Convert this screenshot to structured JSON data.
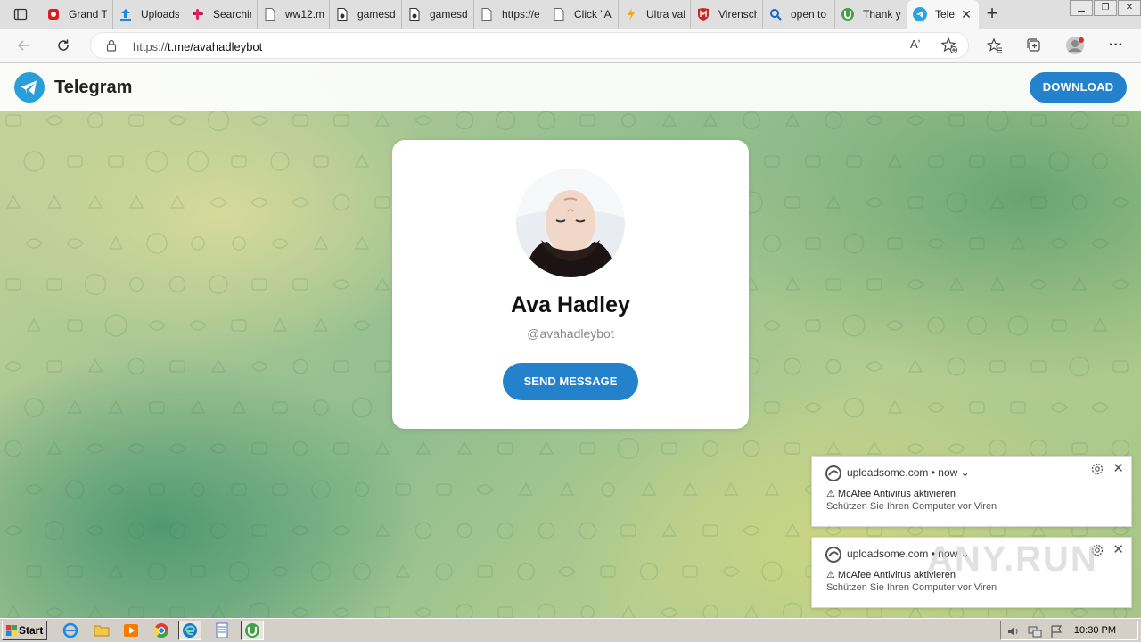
{
  "browser": {
    "tabs": [
      {
        "title": "Grand TI",
        "icon": "red-app-icon",
        "color": "#d81b1b"
      },
      {
        "title": "Uploads",
        "icon": "upload-icon",
        "color": "#1e88e5"
      },
      {
        "title": "Searchin",
        "icon": "slack-icon",
        "color": "#c2185b"
      },
      {
        "title": "ww12.m",
        "icon": "page-icon",
        "color": "#666666"
      },
      {
        "title": "gamesd",
        "icon": "lock-page-icon",
        "color": "#333333"
      },
      {
        "title": "gamesd",
        "icon": "lock-page-icon",
        "color": "#333333"
      },
      {
        "title": "https://e",
        "icon": "page-icon",
        "color": "#666666"
      },
      {
        "title": "Click \"Al",
        "icon": "page-icon",
        "color": "#666666"
      },
      {
        "title": "Ultra val",
        "icon": "lightning-icon",
        "color": "#f5a623"
      },
      {
        "title": "Virensch",
        "icon": "mcafee-icon",
        "color": "#c62828"
      },
      {
        "title": "open to",
        "icon": "search-icon",
        "color": "#1565c0"
      },
      {
        "title": "Thank y",
        "icon": "utorrent-icon",
        "color": "#43a047"
      }
    ],
    "active_tab": {
      "title": "Tele",
      "icon": "telegram-icon"
    },
    "url": "https://t.me/avahadleybot",
    "url_scheme": "https://",
    "url_rest": "t.me/avahadleybot",
    "read_aloud": "Aʼ"
  },
  "telegram": {
    "brand": "Telegram",
    "download_label": "DOWNLOAD",
    "accent": "#2481cc"
  },
  "profile": {
    "name": "Ava Hadley",
    "handle": "@avahadleybot",
    "send_label": "SEND MESSAGE"
  },
  "notifications": [
    {
      "source": "uploadsome.com",
      "time": "now",
      "title": "⚠ McAfee Antivirus aktivieren",
      "body": "Schützen Sie Ihren Computer vor Viren"
    },
    {
      "source": "uploadsome.com",
      "time": "now",
      "title": "⚠ McAfee Antivirus aktivieren",
      "body": "Schützen Sie Ihren Computer vor Viren"
    }
  ],
  "watermark": "ANY.RUN",
  "taskbar": {
    "start_label": "Start",
    "clock": "10:30 PM"
  }
}
